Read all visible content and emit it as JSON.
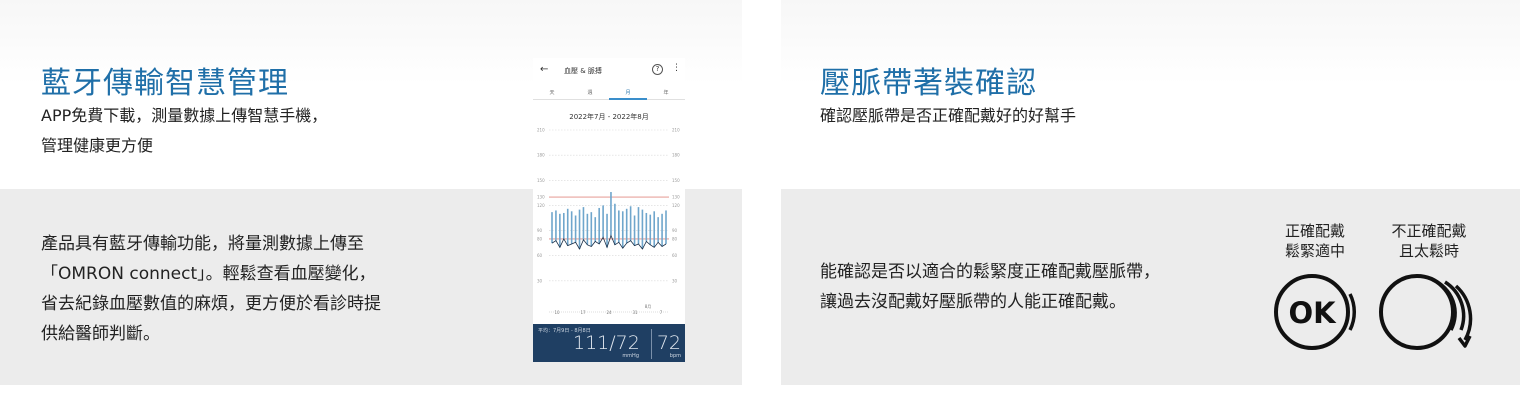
{
  "left": {
    "title": "藍牙傳輸智慧管理",
    "subtitle_lines": [
      "APP免費下載，測量數據上傳智慧手機，",
      "管理健康更方便"
    ],
    "body_lines": [
      "產品具有藍牙傳輸功能，將量測數據上傳至",
      "「OMRON connect」。輕鬆查看血壓變化，",
      "省去紀錄血壓數值的麻煩，更方便於看診時提",
      "供給醫師判斷。"
    ]
  },
  "phone": {
    "back_icon": "arrow-left-icon",
    "app_title": "血壓 & 脈搏",
    "help_icon": "question-circle-icon",
    "more_icon": "more-vertical-icon",
    "tabs": [
      "天",
      "週",
      "月",
      "年"
    ],
    "active_tab": 2,
    "date_range": "2022年7月 - 2022年8月",
    "average_label": "平均：7月9日 - 8月8日",
    "bp_value": "111/72",
    "bp_unit": "mmHg",
    "pulse_value": "72",
    "pulse_unit": "bpm",
    "colors": {
      "accent": "#1f6fa8",
      "bar": "#6fa6cc",
      "target": "#e08a80",
      "footer": "#1f3f63"
    }
  },
  "chart_data": {
    "type": "bar",
    "title": "",
    "xlabel": "",
    "ylabel": "",
    "ylim": [
      0,
      210
    ],
    "yticks": [
      210,
      180,
      150,
      130,
      120,
      90,
      80,
      60,
      30
    ],
    "target_lines": [
      130,
      80
    ],
    "x_tick_labels": [
      "10",
      "17",
      "24",
      "31",
      "7"
    ],
    "x_month_marker": "8月",
    "series": [
      {
        "values": [
          112,
          114,
          110,
          111,
          116,
          113,
          108,
          115,
          118,
          110,
          112,
          106,
          117,
          120,
          110,
          136,
          122,
          114,
          113,
          116,
          119,
          108,
          118,
          115,
          111,
          109,
          113,
          106,
          110,
          114
        ]
      },
      {
        "values": [
          75,
          78,
          70,
          80,
          72,
          74,
          76,
          68,
          79,
          73,
          71,
          77,
          74,
          82,
          70,
          84,
          73,
          76,
          69,
          75,
          78,
          72,
          74,
          68,
          77,
          73,
          70,
          76,
          71,
          74
        ]
      }
    ]
  },
  "right": {
    "title": "壓脈帶著裝確認",
    "subtitle": "確認壓脈帶是否正確配戴好的好幫手",
    "body_lines": [
      "能確認是否以適合的鬆緊度正確配戴壓脈帶，",
      "讓過去沒配戴好壓脈帶的人能正確配戴。"
    ],
    "correct_label_lines": [
      "正確配戴",
      "鬆緊適中"
    ],
    "incorrect_label_lines": [
      "不正確配戴",
      "且太鬆時"
    ],
    "ok_icon_text": "OK",
    "ok_icon": "cuff-ok-icon",
    "loose_icon": "cuff-loose-icon"
  }
}
